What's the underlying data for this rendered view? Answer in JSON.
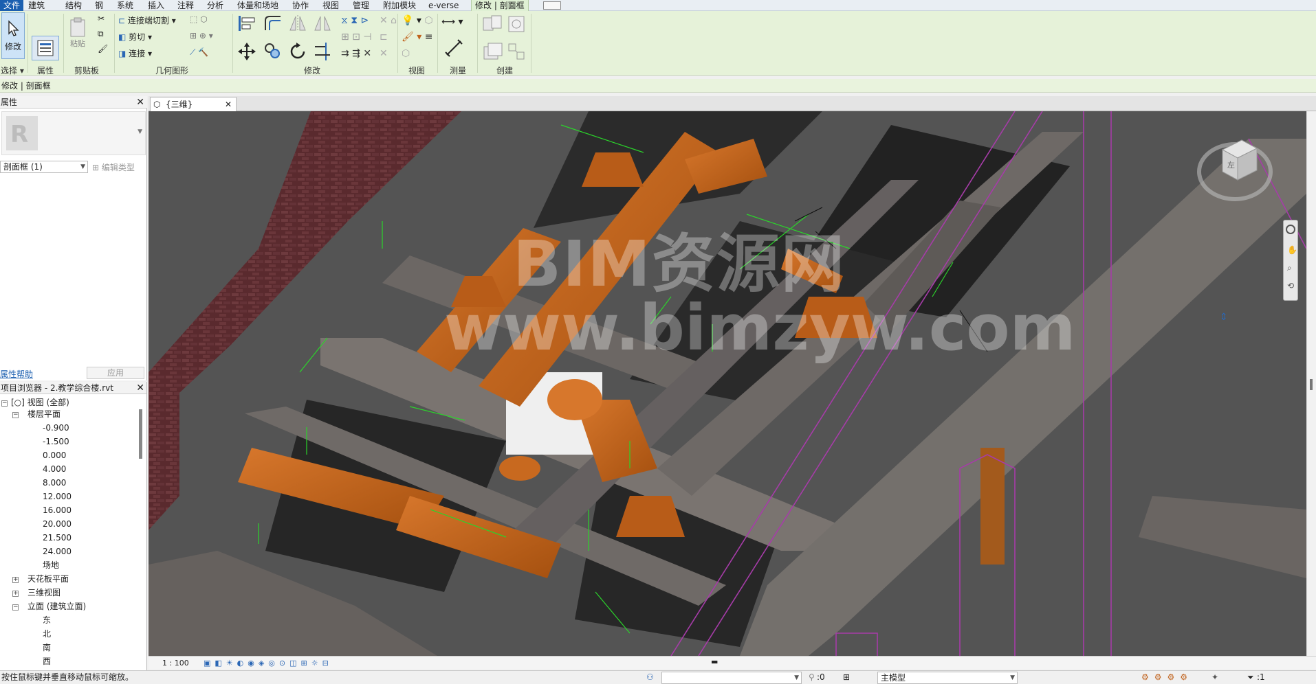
{
  "menu": {
    "tabs": [
      "文件",
      "建筑",
      "结构",
      "钢",
      "系统",
      "插入",
      "注释",
      "分析",
      "体量和场地",
      "协作",
      "视图",
      "管理",
      "附加模块",
      "e-verse",
      "修改 | 剖面框"
    ]
  },
  "ribbon": {
    "modify_label": "修改",
    "paste_label": "粘贴",
    "join_cut_label": "连接端切割",
    "cut_label": "剪切",
    "join_label": "连接",
    "panels": [
      "选择",
      "属性",
      "剪贴板",
      "几何图形",
      "修改",
      "视图",
      "测量",
      "创建"
    ]
  },
  "context_bar": {
    "text": "修改 | 剖面框"
  },
  "properties": {
    "title": "属性",
    "type_selector": "剖面框 (1)",
    "edit_type": "编辑类型",
    "help_link": "属性帮助",
    "apply": "应用"
  },
  "browser": {
    "title": "项目浏览器 - 2.教学综合楼.rvt",
    "root": "视图 (全部)",
    "floor_plans": "楼层平面",
    "levels": [
      "-0.900",
      "-1.500",
      "0.000",
      "4.000",
      "8.000",
      "12.000",
      "16.000",
      "20.000",
      "21.500",
      "24.000",
      "场地"
    ],
    "ceiling_plans": "天花板平面",
    "views_3d": "三维视图",
    "elevations": "立面 (建筑立面)",
    "elevation_items": [
      "东",
      "北",
      "南",
      "西"
    ]
  },
  "view_tab": {
    "label": "{三维}"
  },
  "viewport": {
    "watermark_line1": "BIM资源网",
    "watermark_line2": "www.bimzyw.com",
    "viewcube_face": "左"
  },
  "viewbar": {
    "scale": "1 : 100"
  },
  "status": {
    "message": "按住鼠标键并垂直移动鼠标可缩放。",
    "selection_count": ":0",
    "model": "主模型",
    "filter_count": ":1"
  },
  "colors": {
    "duct": "#c0621c",
    "ribbon_bg": "#e6f2d9",
    "file_tab": "#1b5fb0",
    "section_box": "#a63ca8"
  }
}
